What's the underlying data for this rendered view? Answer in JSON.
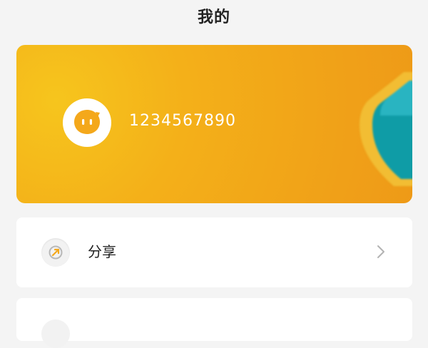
{
  "header": {
    "title": "我的"
  },
  "profile": {
    "user_id": "1234567890",
    "avatar_icon": "chat-bubble-face-icon",
    "accent_color": "#f4a81b"
  },
  "menu": {
    "items": [
      {
        "label": "分享",
        "icon": "share-icon",
        "chevron": "chevron-right-icon"
      },
      {
        "label": "",
        "icon": "menu-icon"
      }
    ]
  }
}
